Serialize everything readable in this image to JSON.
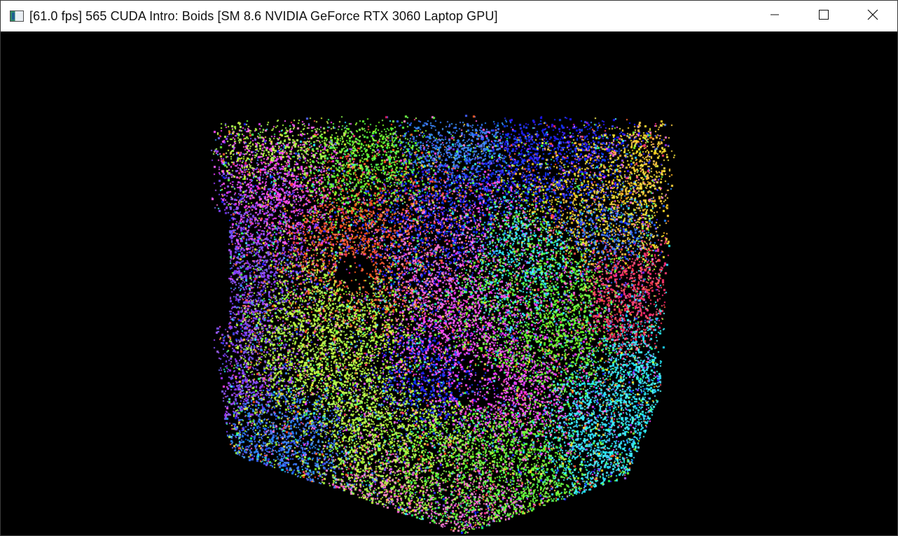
{
  "window": {
    "title": "[61.0 fps] 565 CUDA Intro: Boids [SM 8.6 NVIDIA GeForce RTX 3060 Laptop GPU]",
    "controls": {
      "minimize_icon": "minimize-icon",
      "maximize_icon": "maximize-icon",
      "close_icon": "close-icon"
    }
  },
  "simulation": {
    "background": "#000000",
    "palette": [
      "#ff3b6a",
      "#ff5a2e",
      "#ffd23a",
      "#6bff3a",
      "#2dff7a",
      "#38e6ff",
      "#3a7dff",
      "#1f2bff",
      "#8a4dff",
      "#ff4dff",
      "#ff7ad1",
      "#b6ff4a"
    ]
  }
}
